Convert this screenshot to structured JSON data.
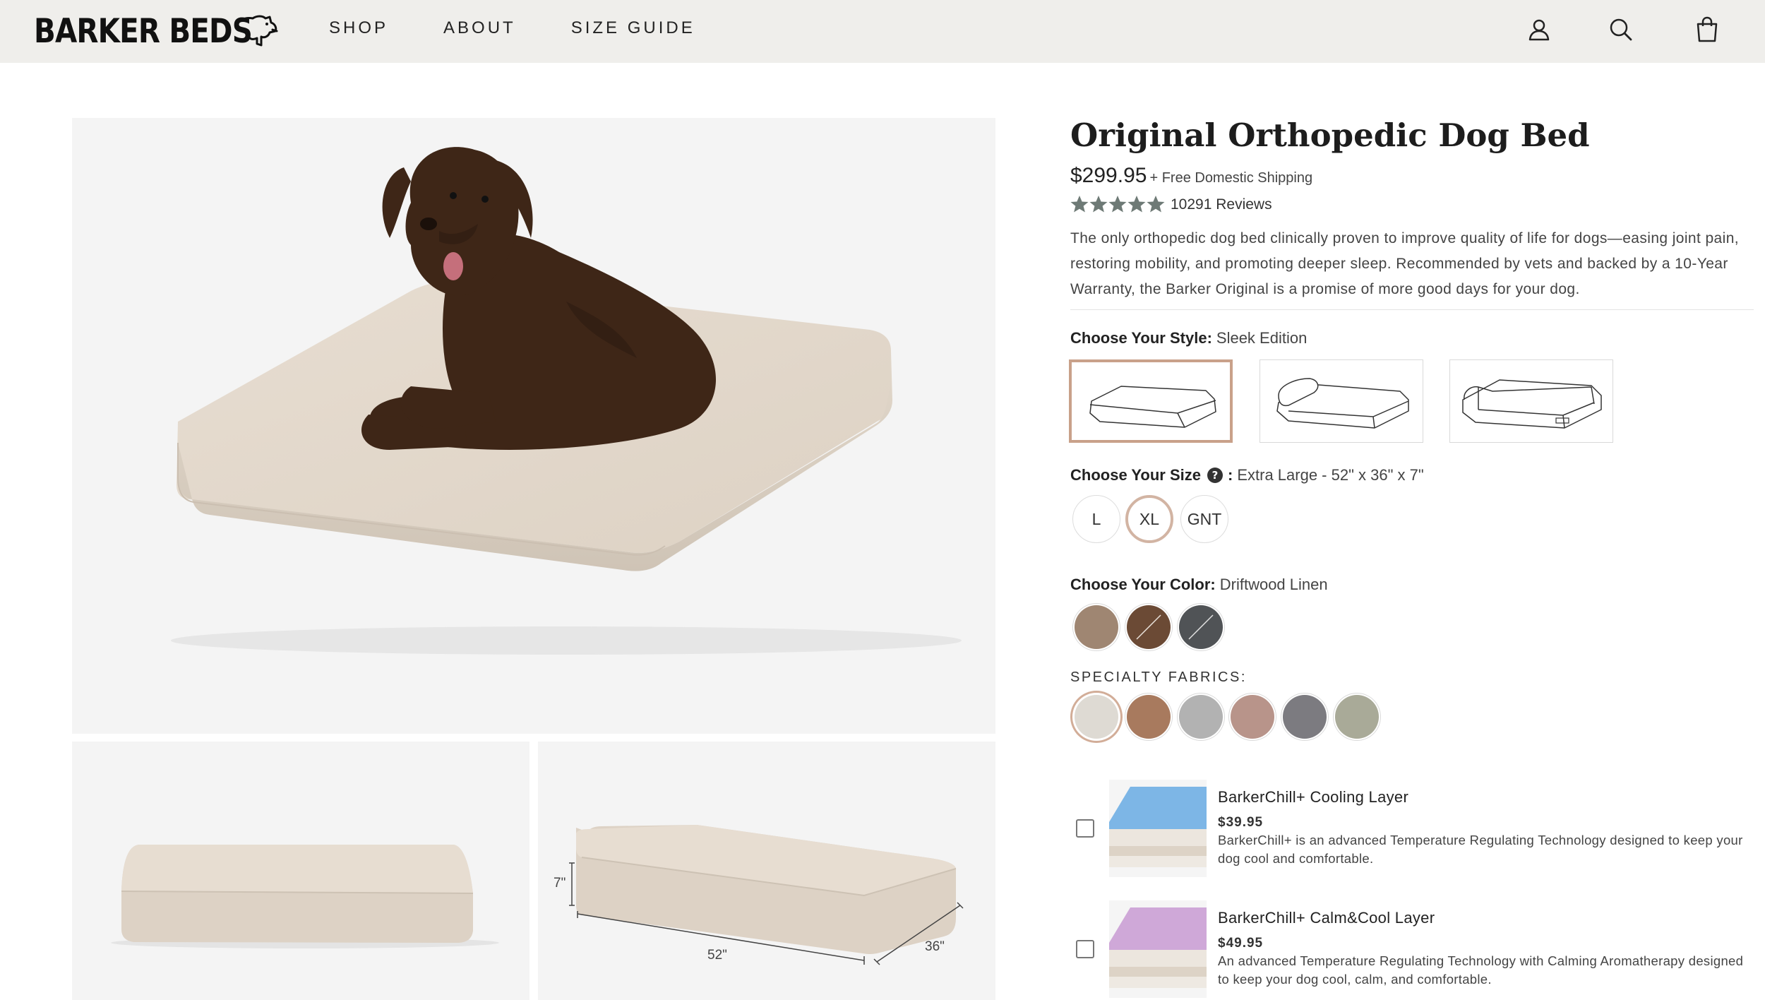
{
  "header": {
    "logo": "BARKER BEDS",
    "nav": [
      "SHOP",
      "ABOUT",
      "SIZE GUIDE"
    ],
    "icons": [
      "account-icon",
      "search-icon",
      "cart-icon"
    ]
  },
  "gallery": {
    "dimension_labels": {
      "height": "7\"",
      "length": "52\"",
      "width": "36\""
    }
  },
  "product": {
    "title": "Original Orthopedic Dog Bed",
    "price": "$299.95",
    "shipping": "+ Free Domestic Shipping",
    "rating": 5,
    "reviews": "10291 Reviews",
    "description": "The only orthopedic dog bed clinically proven to improve quality of life for dogs—easing joint pain, restoring mobility, and promoting deeper sleep. Recommended by vets and backed by a 10-Year Warranty, the Barker Original is a promise of more good days for your dog."
  },
  "style": {
    "label": "Choose Your Style:",
    "value": "Sleek Edition",
    "options": [
      "Sleek Edition",
      "Headrest Edition",
      "Bolster Edition"
    ],
    "selected_index": 0
  },
  "size": {
    "label": "Choose Your Size",
    "help_icon": "question-icon",
    "separator": ":",
    "value": "Extra Large - 52\" x 36\" x 7\"",
    "options": [
      "L",
      "XL",
      "GNT"
    ],
    "selected": "XL"
  },
  "color": {
    "label": "Choose Your Color:",
    "value": "Driftwood Linen",
    "swatches": [
      "#9f8672",
      "#6b4a35",
      "#505356"
    ]
  },
  "specialty": {
    "label": "SPECIALTY FABRICS:",
    "swatches": [
      "#dedad3",
      "#a87a5e",
      "#b2b2b2",
      "#b8948a",
      "#7c7b80",
      "#a9aa98"
    ],
    "selected_index": 0
  },
  "addons": [
    {
      "name": "BarkerChill+ Cooling Layer",
      "price": "$39.95",
      "description": "BarkerChill+ is an advanced Temperature Regulating Technology designed to keep your dog cool and comfortable.",
      "layer_color": "#7db6e6"
    },
    {
      "name": "BarkerChill+ Calm&Cool Layer",
      "price": "$49.95",
      "description": "An advanced Temperature Regulating Technology with Calming Aromatherapy designed to keep your dog cool, calm, and comfortable.",
      "layer_color": "#cfa8d8"
    }
  ],
  "colors": {
    "header_bg": "#efeeeb",
    "star": "#6e7a76",
    "selected_border": "#c9a18a"
  }
}
